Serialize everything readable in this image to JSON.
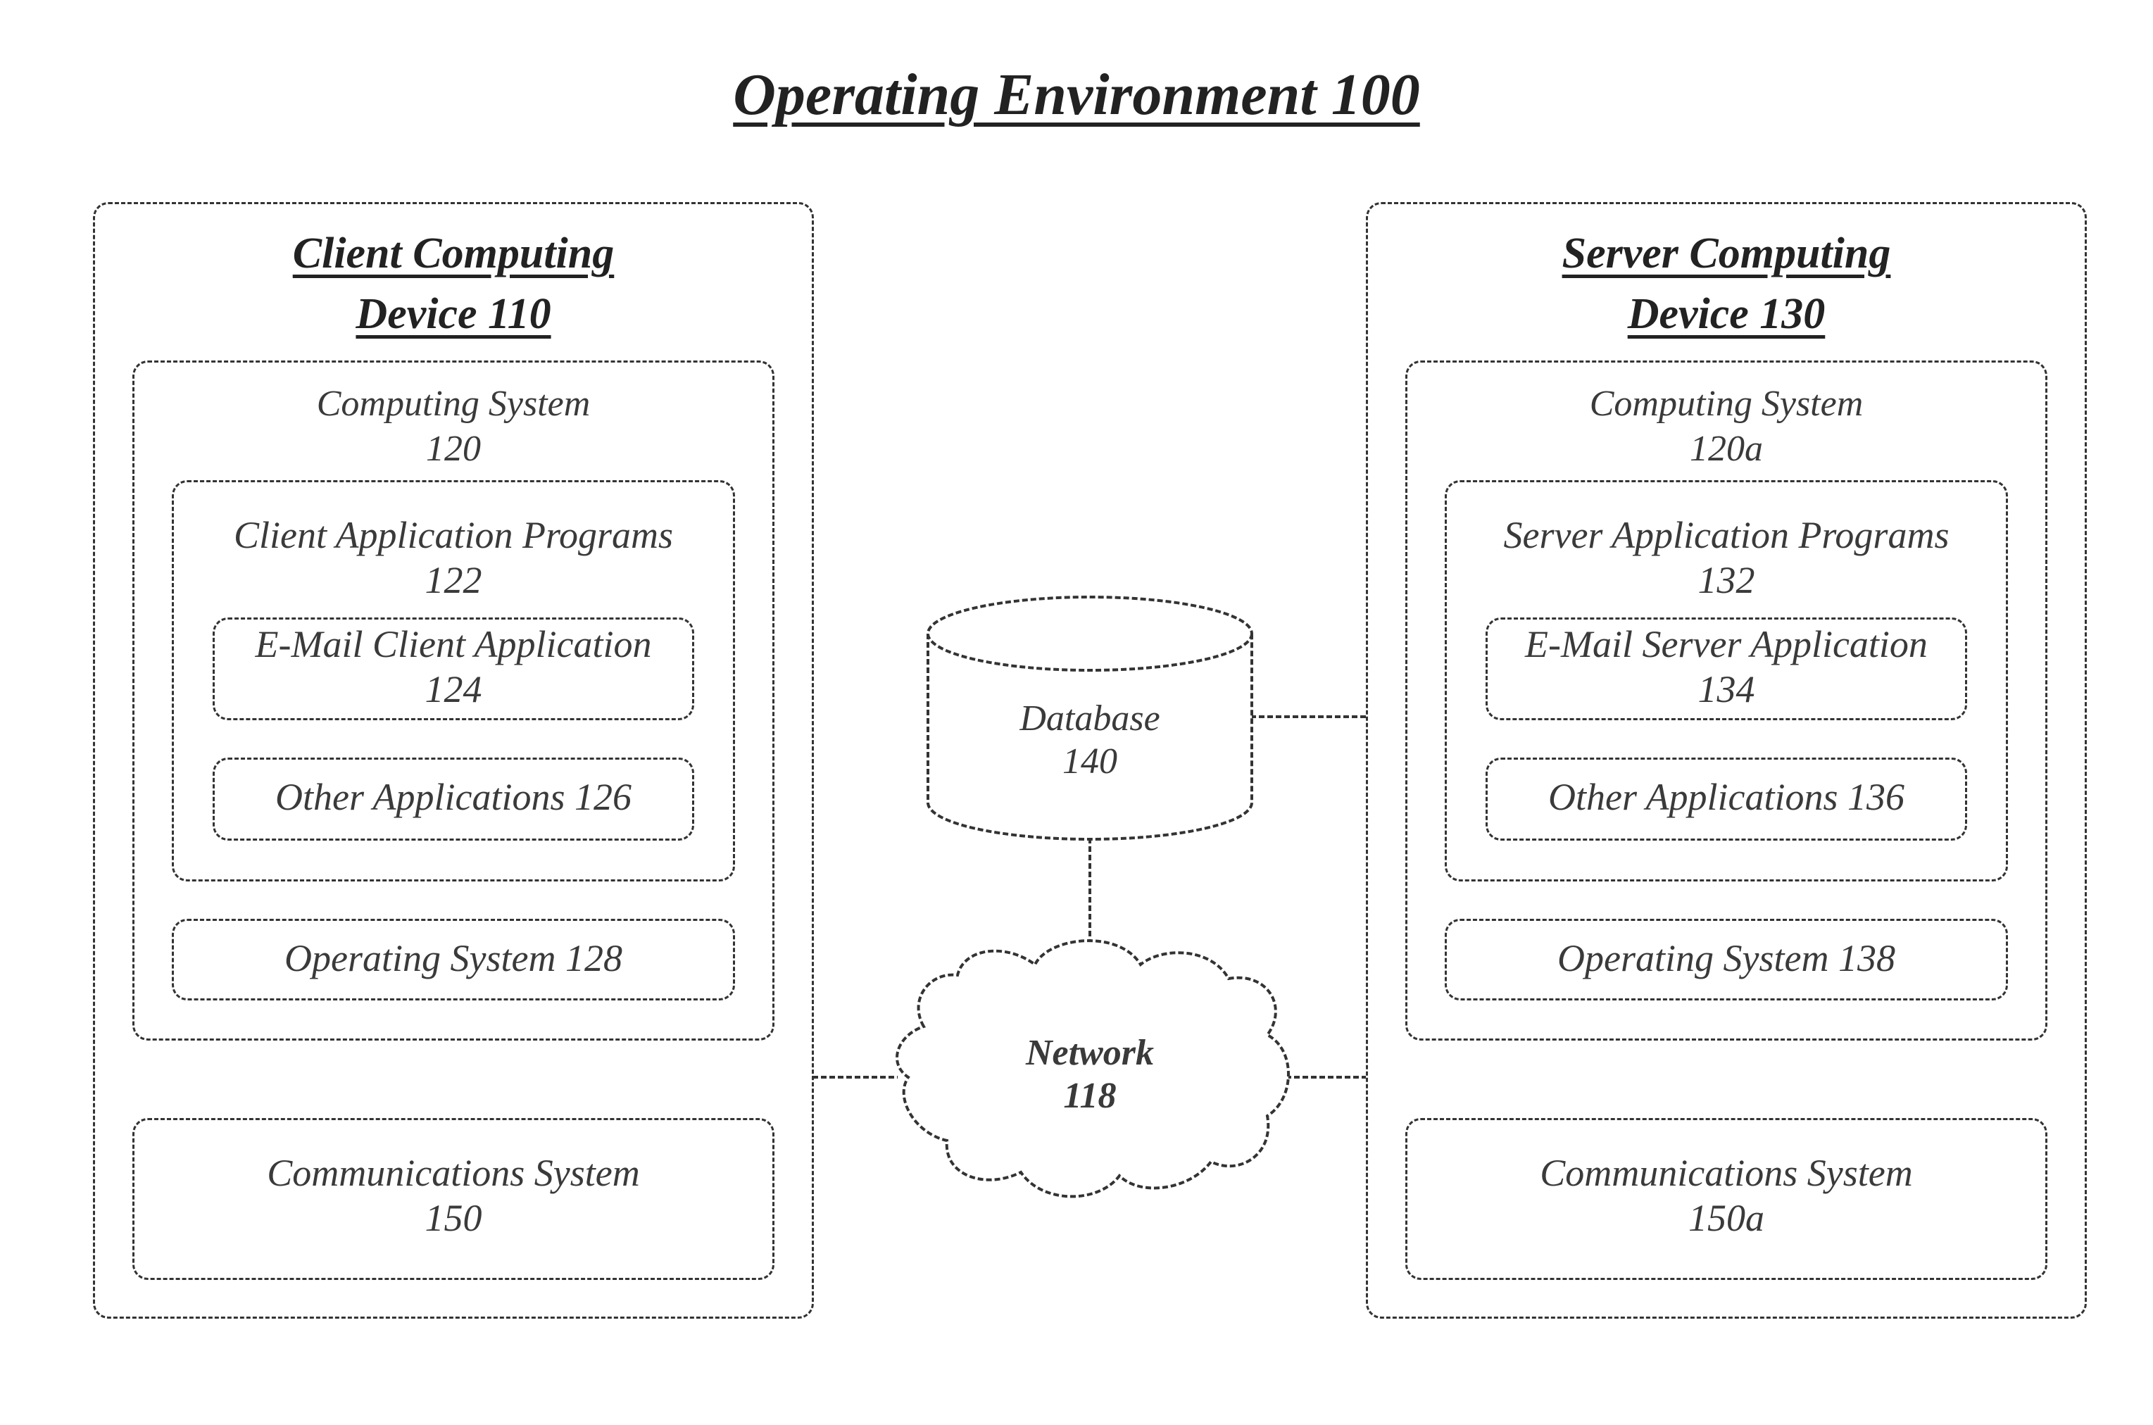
{
  "diagram": {
    "title": "Operating Environment 100",
    "client": {
      "title_line1": "Client Computing",
      "title_line2": "Device 110",
      "computing_system": {
        "label": "Computing System",
        "ref": "120"
      },
      "app_programs": {
        "label": "Client Application Programs",
        "ref": "122"
      },
      "email_app": {
        "label": "E-Mail Client Application",
        "ref": "124"
      },
      "other_apps": {
        "label": "Other Applications 126"
      },
      "os": {
        "label": "Operating System 128"
      },
      "comms": {
        "label": "Communications System",
        "ref": "150"
      }
    },
    "server": {
      "title_line1": "Server Computing",
      "title_line2": "Device 130",
      "computing_system": {
        "label": "Computing System",
        "ref": "120a"
      },
      "app_programs": {
        "label": "Server Application Programs",
        "ref": "132"
      },
      "email_app": {
        "label": "E-Mail Server Application",
        "ref": "134"
      },
      "other_apps": {
        "label": "Other Applications 136"
      },
      "os": {
        "label": "Operating System 138"
      },
      "comms": {
        "label": "Communications System",
        "ref": "150a"
      }
    },
    "database": {
      "label": "Database",
      "ref": "140"
    },
    "network": {
      "label": "Network",
      "ref": "118"
    },
    "connections": [
      {
        "from": "Client Computing Device 110",
        "to": "Network 118"
      },
      {
        "from": "Network 118",
        "to": "Server Computing Device 130"
      },
      {
        "from": "Database 140",
        "to": "Network 118"
      },
      {
        "from": "Database 140",
        "to": "Server Computing Device 130"
      }
    ]
  }
}
